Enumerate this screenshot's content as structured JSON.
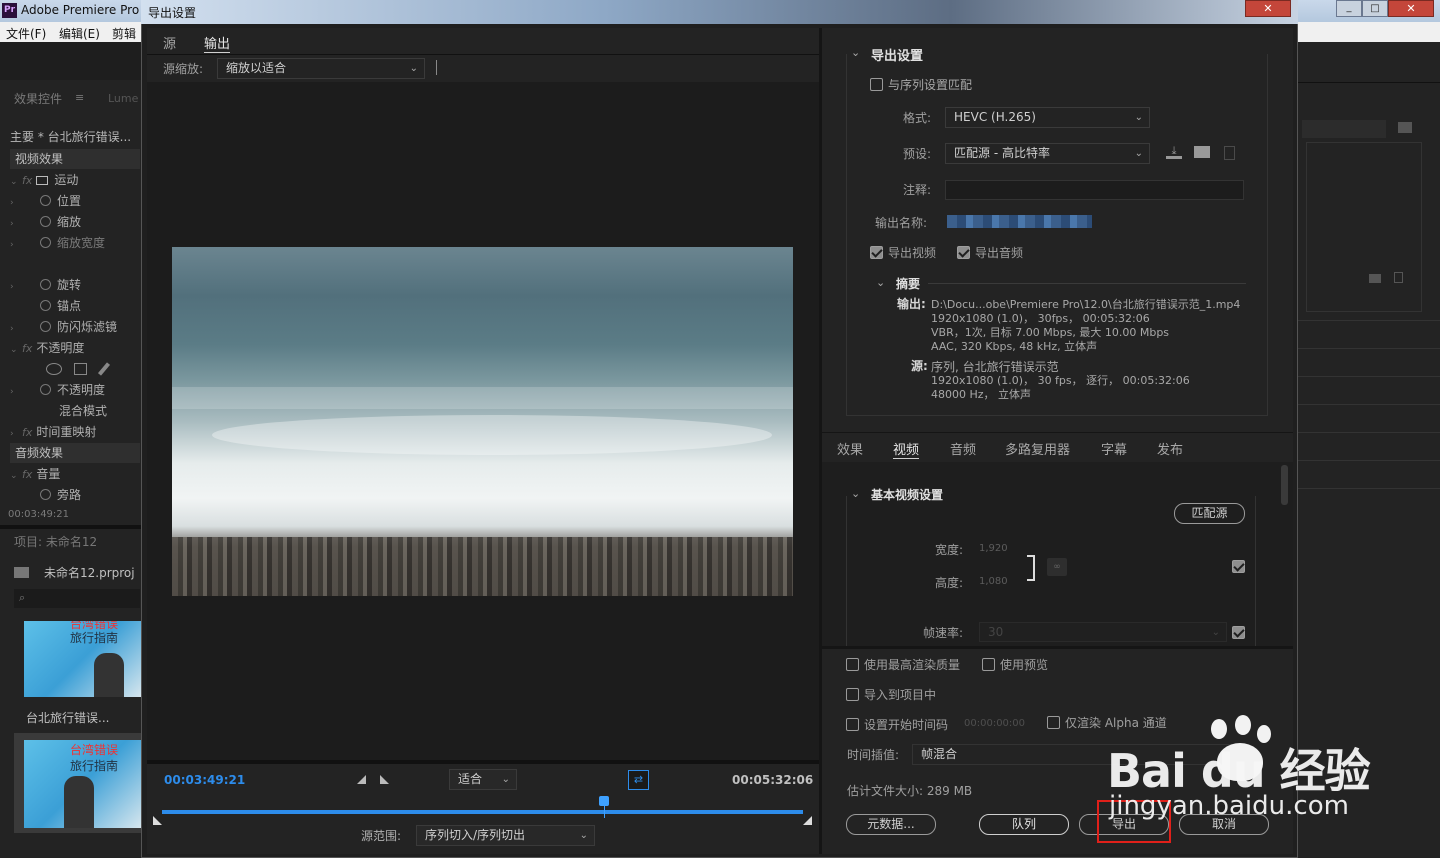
{
  "app": {
    "title": "Adobe Premiere Pro",
    "menu": [
      "文件(F)",
      "编辑(E)",
      "剪辑"
    ]
  },
  "left": {
    "panel_tab": "效果控件",
    "panel_tab2": "Lume",
    "clip": "主要 * 台北旅行错误...",
    "video_effects": "视频效果",
    "items": [
      "运动",
      "位置",
      "缩放",
      "缩放宽度",
      "旋转",
      "锚点",
      "防闪烁滤镜",
      "不透明度",
      "不透明度",
      "混合模式",
      "时间重映射"
    ],
    "audio_effects": "音频效果",
    "audio_items": [
      "音量",
      "旁路"
    ],
    "timecode": "00:03:49:21",
    "project_title": "项目: 未命名12",
    "project_file": "未命名12.prproj",
    "thumb_label": "台北旅行错误...",
    "thumb_text1": "台湾错误",
    "thumb_text2": "旅行指南"
  },
  "dialog": {
    "title": "导出设置",
    "close": "x",
    "tabs": [
      "源",
      "输出"
    ],
    "source_scale_label": "源缩放:",
    "source_scale_value": "缩放以适合",
    "current_time": "00:03:49:21",
    "fit": "适合",
    "duration": "00:05:32:06",
    "source_range_label": "源范围:",
    "source_range_value": "序列切入/序列切出",
    "playhead_fraction": 0.69,
    "export_settings": {
      "header": "导出设置",
      "match_sequence": "与序列设置匹配",
      "format_label": "格式:",
      "format_value": "HEVC (H.265)",
      "preset_label": "预设:",
      "preset_value": "匹配源 - 高比特率",
      "comment_label": "注释:",
      "output_name_label": "输出名称:",
      "export_video": "导出视频",
      "export_audio": "导出音频",
      "summary_header": "摘要",
      "output_label": "输出:",
      "output_lines": [
        "D:\\Docu...obe\\Premiere Pro\\12.0\\台北旅行错误示范_1.mp4",
        "1920x1080 (1.0)， 30fps， 00:05:32:06",
        "VBR，1次, 目标 7.00 Mbps, 最大 10.00 Mbps",
        "AAC, 320 Kbps, 48  kHz, 立体声"
      ],
      "source_label": "源:",
      "source_lines": [
        "序列, 台北旅行错误示范",
        "1920x1080 (1.0)， 30 fps， 逐行， 00:05:32:06",
        "48000 Hz， 立体声"
      ]
    },
    "settings_tabs": [
      "效果",
      "视频",
      "音频",
      "多路复用器",
      "字幕",
      "发布"
    ],
    "basic_video": {
      "header": "基本视频设置",
      "match_source": "匹配源",
      "width_label": "宽度:",
      "width_value": "1,920",
      "height_label": "高度:",
      "height_value": "1,080",
      "framerate_label": "帧速率:",
      "framerate_value": "30"
    },
    "bottom": {
      "max_render": "使用最高渲染质量",
      "use_preview": "使用预览",
      "import_project": "导入到项目中",
      "set_start_tc": "设置开始时间码",
      "start_tc_value": "00:00:00:00",
      "render_alpha": "仅渲染 Alpha 通道",
      "interp_label": "时间插值:",
      "interp_value": "帧混合",
      "file_size": "估计文件大小: 289 MB",
      "metadata": "元数据...",
      "queue": "队列",
      "export": "导出",
      "cancel": "取消"
    }
  },
  "watermark": {
    "brand": "Bai du 经验",
    "url": "jingyan.baidu.com"
  },
  "colors": {
    "accent": "#2d8ceb",
    "highlight_box": "#e0201a"
  }
}
